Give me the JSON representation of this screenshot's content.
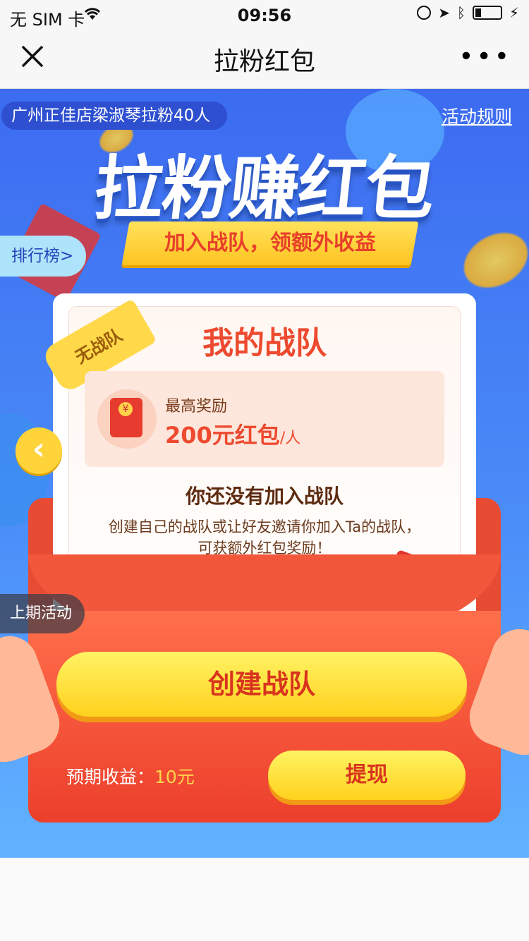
{
  "status": {
    "carrier": "无 SIM 卡",
    "time": "09:56"
  },
  "nav": {
    "title": "拉粉红包",
    "more": "•••"
  },
  "top_tag": "广州正佳店梁淑琴拉粉40人",
  "rules_link": "活动规则",
  "hero_title": "拉粉赚红包",
  "ribbon_text": "加入战队，领额外收益",
  "rank_button": "排行榜>",
  "card": {
    "badge": "无战队",
    "title": "我的战队",
    "reward_label": "最高奖励",
    "reward_value": "200元红包",
    "reward_unit": "/人",
    "not_joined": "你还没有加入战队",
    "desc_line1": "创建自己的战队或让好友邀请你加入Ta的战队，",
    "desc_line2": "可获额外红包奖励！"
  },
  "last_activity": "上期活动",
  "create_button": "创建战队",
  "earnings": {
    "label": "预期收益：",
    "value": "10元"
  },
  "withdraw_button": "提现",
  "colors": {
    "primary_blue": "#3c6bf0",
    "accent_red": "#ed4a2f",
    "gold": "#ffd11d"
  }
}
